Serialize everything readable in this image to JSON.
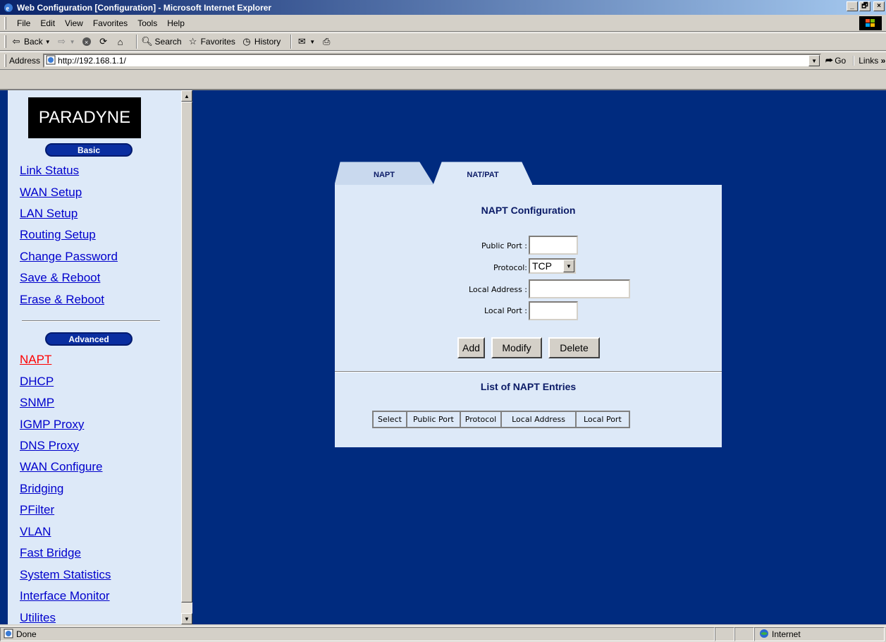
{
  "window": {
    "title": "Web Configuration [Configuration] - Microsoft Internet Explorer",
    "min": "_",
    "max": "🗗",
    "close": "×"
  },
  "menu": [
    "File",
    "Edit",
    "View",
    "Favorites",
    "Tools",
    "Help"
  ],
  "toolbar": {
    "back": "Back",
    "search": "Search",
    "favorites": "Favorites",
    "history": "History"
  },
  "address": {
    "label": "Address",
    "url": "http://192.168.1.1/",
    "go": "Go",
    "links": "Links"
  },
  "sidebar": {
    "logo": "PARADYNE",
    "basic_label": "Basic",
    "basic_items": [
      "Link Status",
      "WAN Setup",
      "LAN Setup",
      "Routing Setup",
      "Change Password",
      "Save & Reboot",
      "Erase & Reboot"
    ],
    "advanced_label": "Advanced",
    "advanced_items": [
      "NAPT",
      "DHCP",
      "SNMP",
      "IGMP Proxy",
      "DNS Proxy",
      "WAN Configure",
      "Bridging",
      "PFilter",
      "VLAN",
      "Fast Bridge",
      "System Statistics",
      "Interface Monitor",
      "Utilites"
    ],
    "active_item": "NAPT"
  },
  "tabs": [
    "NAPT",
    "NAT/PAT"
  ],
  "form": {
    "title": "NAPT Configuration",
    "public_port_label": "Public Port :",
    "protocol_label": "Protocol:",
    "protocol_value": "TCP",
    "local_address_label": "Local Address :",
    "local_port_label": "Local Port :",
    "add": "Add",
    "modify": "Modify",
    "delete": "Delete"
  },
  "list": {
    "title": "List of NAPT Entries",
    "columns": [
      "Select",
      "Public Port",
      "Protocol",
      "Local Address",
      "Local Port"
    ]
  },
  "status": {
    "text": "Done",
    "zone": "Internet"
  },
  "colors": {
    "page_bg": "#002b7f",
    "panel_bg": "#dde9f8",
    "link": "#0000cc",
    "active_link": "#ff0000",
    "pill": "#0a2ea0"
  }
}
